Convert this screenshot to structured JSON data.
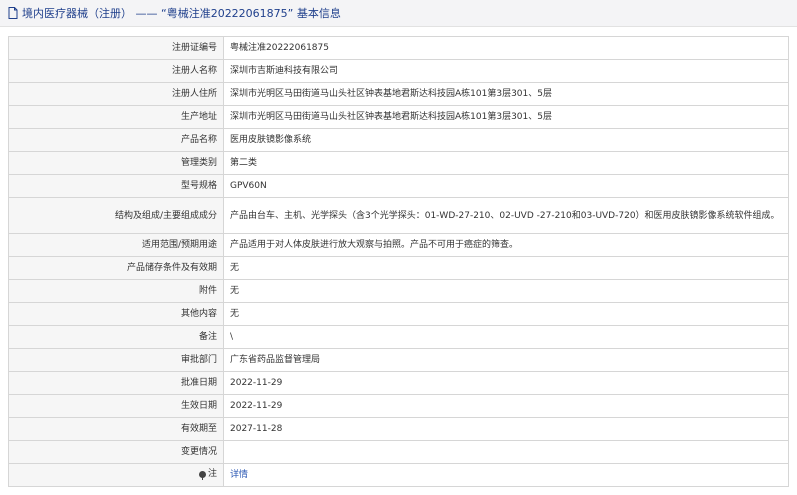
{
  "header": {
    "title": "境内医疗器械（注册） —— “粤械注准20222061875” 基本信息"
  },
  "rows": [
    {
      "key": "注册证编号",
      "value": "粤械注准20222061875"
    },
    {
      "key": "注册人名称",
      "value": "深圳市吉斯迪科技有限公司"
    },
    {
      "key": "注册人住所",
      "value": "深圳市光明区马田街道马山头社区钟表基地君斯达科技园A栋101第3层301、5层"
    },
    {
      "key": "生产地址",
      "value": "深圳市光明区马田街道马山头社区钟表基地君斯达科技园A栋101第3层301、5层"
    },
    {
      "key": "产品名称",
      "value": "医用皮肤镜影像系统"
    },
    {
      "key": "管理类别",
      "value": "第二类"
    },
    {
      "key": "型号规格",
      "value": "GPV60N"
    },
    {
      "key": "结构及组成/主要组成成分",
      "value": "产品由台车、主机、光学探头（含3个光学探头：01-WD-27-210、02-UVD -27-210和03-UVD-720）和医用皮肤镜影像系统软件组成。"
    },
    {
      "key": "适用范围/预期用途",
      "value": "产品适用于对人体皮肤进行放大观察与拍照。产品不可用于癌症的筛查。"
    },
    {
      "key": "产品储存条件及有效期",
      "value": "无"
    },
    {
      "key": "附件",
      "value": "无"
    },
    {
      "key": "其他内容",
      "value": "无"
    },
    {
      "key": "备注",
      "value": "\\"
    },
    {
      "key": "审批部门",
      "value": "广东省药品监督管理局"
    },
    {
      "key": "批准日期",
      "value": "2022-11-29"
    },
    {
      "key": "生效日期",
      "value": "2022-11-29"
    },
    {
      "key": "有效期至",
      "value": "2027-11-28"
    },
    {
      "key": "变更情况",
      "value": ""
    }
  ],
  "note_row": {
    "key": "注",
    "icon": "pin-icon",
    "link": "详情"
  },
  "colors": {
    "title": "#1f3f8c",
    "link": "#2a57b3",
    "key_bg": "#f6f6f6"
  }
}
